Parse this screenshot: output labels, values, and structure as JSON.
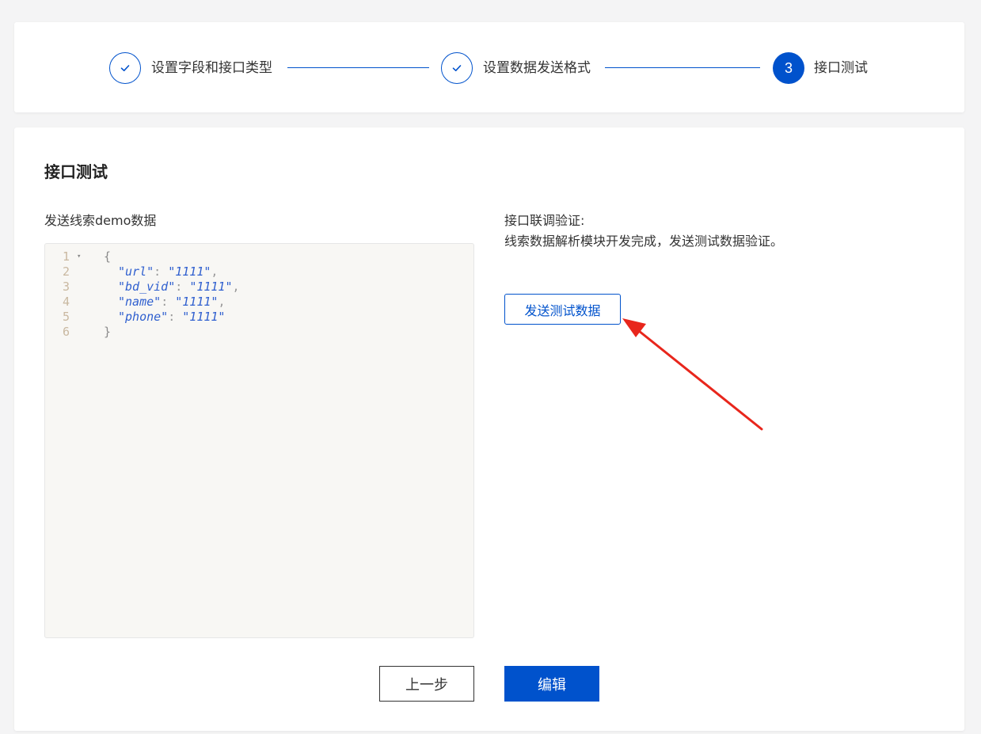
{
  "steps": [
    {
      "label": "设置字段和接口类型",
      "status": "done"
    },
    {
      "label": "设置数据发送格式",
      "status": "done"
    },
    {
      "label": "接口测试",
      "status": "active",
      "number": "3"
    }
  ],
  "main": {
    "title": "接口测试",
    "demo_label": "发送线索demo数据",
    "code_lines": [
      {
        "n": "1",
        "fold": "▾",
        "text": "{"
      },
      {
        "n": "2",
        "key": "\"url\"",
        "value": "\"1111\"",
        "tail": ","
      },
      {
        "n": "3",
        "key": "\"bd_vid\"",
        "value": "\"1111\"",
        "tail": ","
      },
      {
        "n": "4",
        "key": "\"name\"",
        "value": "\"1111\"",
        "tail": ","
      },
      {
        "n": "5",
        "key": "\"phone\"",
        "value": "\"1111\"",
        "tail": ""
      },
      {
        "n": "6",
        "text": "}"
      }
    ],
    "verify_title": "接口联调验证:",
    "verify_desc": "线索数据解析模块开发完成，发送测试数据验证。",
    "send_button": "发送测试数据",
    "prev_button": "上一步",
    "edit_button": "编辑"
  },
  "colors": {
    "accent": "#0052cc",
    "annotation_arrow": "#e8261c"
  }
}
